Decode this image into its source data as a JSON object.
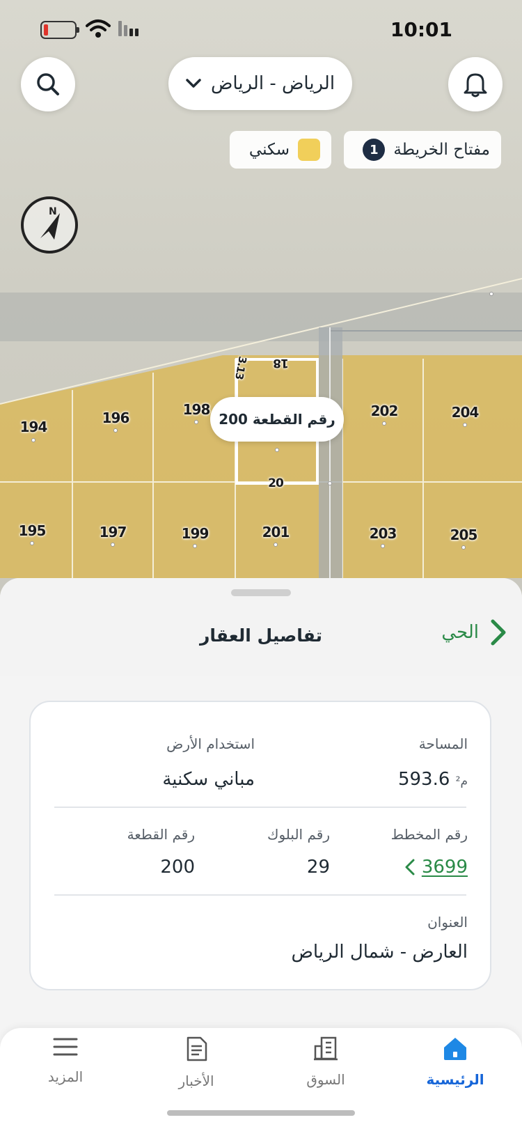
{
  "status_bar": {
    "time": "10:01"
  },
  "header": {
    "city_selector": "الرياض - الرياض",
    "search_icon": "search-icon",
    "notifications_icon": "bell-icon"
  },
  "map_key": {
    "label": "مفتاح الخريطة",
    "count": "1"
  },
  "legend": {
    "label": "سكني",
    "color": "#f1cf5a"
  },
  "map": {
    "plot_tooltip": "رقم القطعة 200",
    "street_labels": {
      "top": "18",
      "bottom": "20",
      "side": "3.13"
    },
    "plots": [
      "194",
      "196",
      "198",
      "202",
      "204",
      "195",
      "197",
      "199",
      "201",
      "203",
      "205"
    ]
  },
  "sheet": {
    "title": "تفاصيل العقار",
    "district_link": "الحي",
    "area_label": "المساحة",
    "area_value": "593.6",
    "area_unit": "م²",
    "land_use_label": "استخدام الأرض",
    "land_use_value": "مباني سكنية",
    "plan_label": "رقم المخطط",
    "plan_value": "3699",
    "block_label": "رقم البلوك",
    "block_value": "29",
    "plot_label": "رقم القطعة",
    "plot_value": "200",
    "address_label": "العنوان",
    "address_value": "العارض - شمال الرياض"
  },
  "tabs": [
    {
      "label": "الرئيسية",
      "icon": "home-icon",
      "active": true
    },
    {
      "label": "السوق",
      "icon": "building-icon",
      "active": false
    },
    {
      "label": "الأخبار",
      "icon": "news-icon",
      "active": false
    },
    {
      "label": "المزيد",
      "icon": "menu-icon",
      "active": false
    }
  ],
  "colors": {
    "accent_green": "#2a8a47",
    "active_blue": "#1565d8",
    "residential": "#f1cf5a"
  }
}
